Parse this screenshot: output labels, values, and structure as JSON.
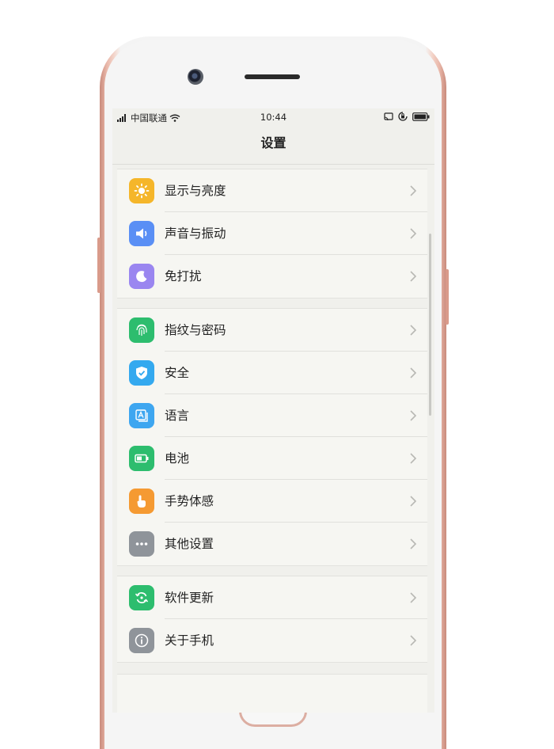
{
  "status_bar": {
    "carrier": "中国联通",
    "time": "10:44"
  },
  "header": {
    "title": "设置"
  },
  "groups": [
    {
      "items": [
        {
          "label": "显示与亮度",
          "icon": "sun-icon",
          "color": "#f5b62a"
        },
        {
          "label": "声音与振动",
          "icon": "speaker-icon",
          "color": "#5a8ff5"
        },
        {
          "label": "免打扰",
          "icon": "moon-icon",
          "color": "#9a86f0"
        }
      ]
    },
    {
      "items": [
        {
          "label": "指纹与密码",
          "icon": "fingerprint-icon",
          "color": "#2dbd6e"
        },
        {
          "label": "安全",
          "icon": "shield-icon",
          "color": "#34a9ef"
        },
        {
          "label": "语言",
          "icon": "language-icon",
          "color": "#3ea6f0"
        },
        {
          "label": "电池",
          "icon": "battery-icon",
          "color": "#2dbd6e"
        },
        {
          "label": "手势体感",
          "icon": "hand-gesture-icon",
          "color": "#f59a32"
        },
        {
          "label": "其他设置",
          "icon": "more-dots-icon",
          "color": "#8f949a"
        }
      ]
    },
    {
      "items": [
        {
          "label": "软件更新",
          "icon": "update-icon",
          "color": "#2dbd6e"
        },
        {
          "label": "关于手机",
          "icon": "info-icon",
          "color": "#8f949a"
        }
      ]
    }
  ]
}
